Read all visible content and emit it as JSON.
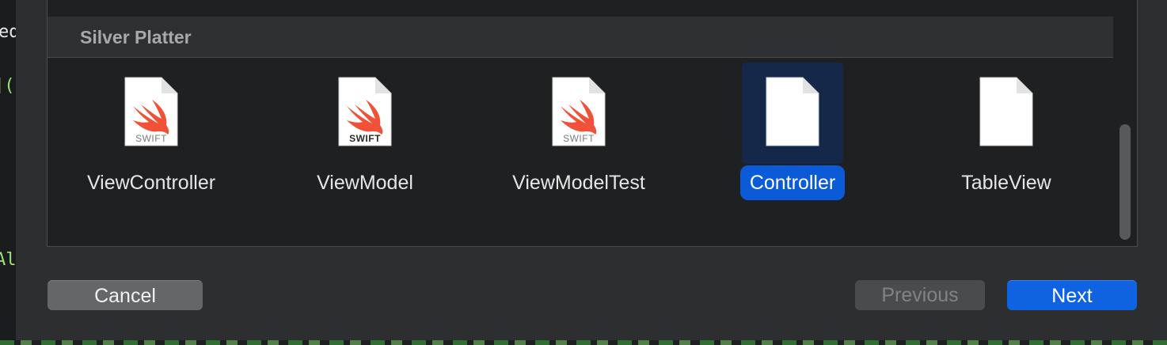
{
  "editor": {
    "fragment_top": "ed",
    "fragment_mid": "](",
    "fragment_low": "Al"
  },
  "section": {
    "title": "Silver Platter"
  },
  "templates": [
    {
      "name": "ViewController",
      "kind": "swift",
      "badge": "SWIFT",
      "selected": false
    },
    {
      "name": "ViewModel",
      "kind": "swift",
      "badge": "SWIFT",
      "selected": false
    },
    {
      "name": "ViewModelTest",
      "kind": "swift",
      "badge": "SWIFT",
      "selected": false
    },
    {
      "name": "Controller",
      "kind": "blank",
      "badge": "",
      "selected": true
    },
    {
      "name": "TableView",
      "kind": "blank",
      "badge": "",
      "selected": false
    }
  ],
  "buttons": {
    "cancel": "Cancel",
    "previous": "Previous",
    "next": "Next"
  },
  "colors": {
    "accent": "#0f63e0",
    "selection_bg": "#15284a",
    "swift_orange": "#f05138"
  }
}
